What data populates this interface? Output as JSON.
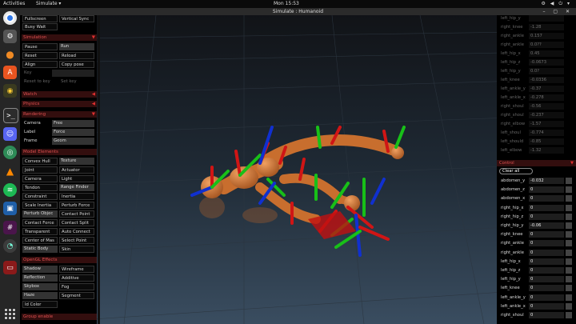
{
  "topbar": {
    "activities": "Activities",
    "app": "Simulate ▾",
    "clock": "Mon 15:53",
    "tray": "⚙ ◀ ⏻ ▾"
  },
  "window": {
    "title": "Simulate : Humanoid",
    "controls": "– ▢ ✕"
  },
  "dock": {
    "icons": [
      "chrome-icon",
      "gear-settings-icon",
      "blender-icon",
      "software-center-icon",
      "firefox-icon",
      "terminal-icon",
      "discord-icon",
      "globe-icon",
      "vlc-icon",
      "spotify-icon",
      "virtualbox-icon",
      "slack-icon",
      "dashboard-icon",
      "monitor-icon"
    ]
  },
  "left": {
    "top_buttons": [
      "Fullscreen",
      "Vertical Sync",
      "Busy Wait"
    ],
    "simulation": {
      "title": "Simulation",
      "buttons": [
        "Pause",
        "Run",
        "Reset",
        "Reload",
        "Align",
        "Copy pose"
      ],
      "key_label": "Key",
      "reset_to_key": "Reset to key",
      "set_key": "Set key"
    },
    "watch": {
      "title": "Watch"
    },
    "physics": {
      "title": "Physics"
    },
    "rendering": {
      "title": "Rendering",
      "rows": [
        [
          "Camera",
          "Free"
        ],
        [
          "Label",
          "Force"
        ],
        [
          "Frame",
          "Geom"
        ]
      ]
    },
    "model_elements": {
      "title": "Model Elements",
      "buttons": [
        "Convex Hull",
        "Texture",
        "Joint",
        "Actuator",
        "Camera",
        "Light",
        "Tendon",
        "Range Finder",
        "Constraint",
        "Inertia",
        "Scale Inertia",
        "Perturb Force",
        "Perturb Objec",
        "Contact Point",
        "Contact Force",
        "Contact Split",
        "Transparent",
        "Auto Connect",
        "Center of Mas",
        "Select Point",
        "Static Body",
        "Skin"
      ]
    },
    "opengl": {
      "title": "OpenGL Effects",
      "buttons": [
        "Shadow",
        "Wireframe",
        "Reflection",
        "Additive",
        "Skybox",
        "Fog",
        "Haze",
        "Segment",
        "Id Color"
      ]
    },
    "group_enable": {
      "title": "Group enable"
    }
  },
  "right": {
    "joints": [
      [
        "left_hip_y",
        ""
      ],
      [
        "right_knee",
        "-1.28"
      ],
      [
        "right_ankle",
        "0.157"
      ],
      [
        "right_ankle",
        "0.0??"
      ],
      [
        "left_hip_x",
        "0.45"
      ],
      [
        "left_hip_z",
        "-0.0673"
      ],
      [
        "left_hip_y",
        "0.0?"
      ],
      [
        "left_knee",
        "-0.0336"
      ],
      [
        "left_ankle_y",
        "-0.37"
      ],
      [
        "left_ankle_x",
        "-0.278"
      ],
      [
        "right_shoul",
        "-0.56"
      ],
      [
        "right_shoul",
        "-0.237"
      ],
      [
        "right_elbow",
        "-1.57"
      ],
      [
        "left_shoul",
        "-0.774"
      ],
      [
        "left_should",
        "-0.85"
      ],
      [
        "left_elbow",
        "-1.32"
      ]
    ],
    "control": {
      "title": "Control",
      "clear_all": "Clear all",
      "rows": [
        [
          "abdomen_y",
          "-0.032"
        ],
        [
          "abdomen_z",
          "0"
        ],
        [
          "abdomen_x",
          "0"
        ],
        [
          "right_hip_x",
          "0"
        ],
        [
          "right_hip_z",
          "0"
        ],
        [
          "right_hip_y",
          "-0.06"
        ],
        [
          "right_knee",
          "0"
        ],
        [
          "right_ankle",
          "0"
        ],
        [
          "right_ankle",
          "0"
        ],
        [
          "left_hip_x",
          "0"
        ],
        [
          "left_hip_z",
          "0"
        ],
        [
          "left_hip_y",
          "0"
        ],
        [
          "left_knee",
          "0"
        ],
        [
          "left_ankle_y",
          "0"
        ],
        [
          "left_ankle_x",
          "0"
        ],
        [
          "right_shoul",
          "0"
        ]
      ]
    }
  },
  "colors": {
    "section_bg": "#330e0e",
    "section_text": "#e05050",
    "body_orange": "#d07a35",
    "axis_red": "#e01010",
    "axis_green": "#10c010",
    "axis_blue": "#1030e0"
  }
}
